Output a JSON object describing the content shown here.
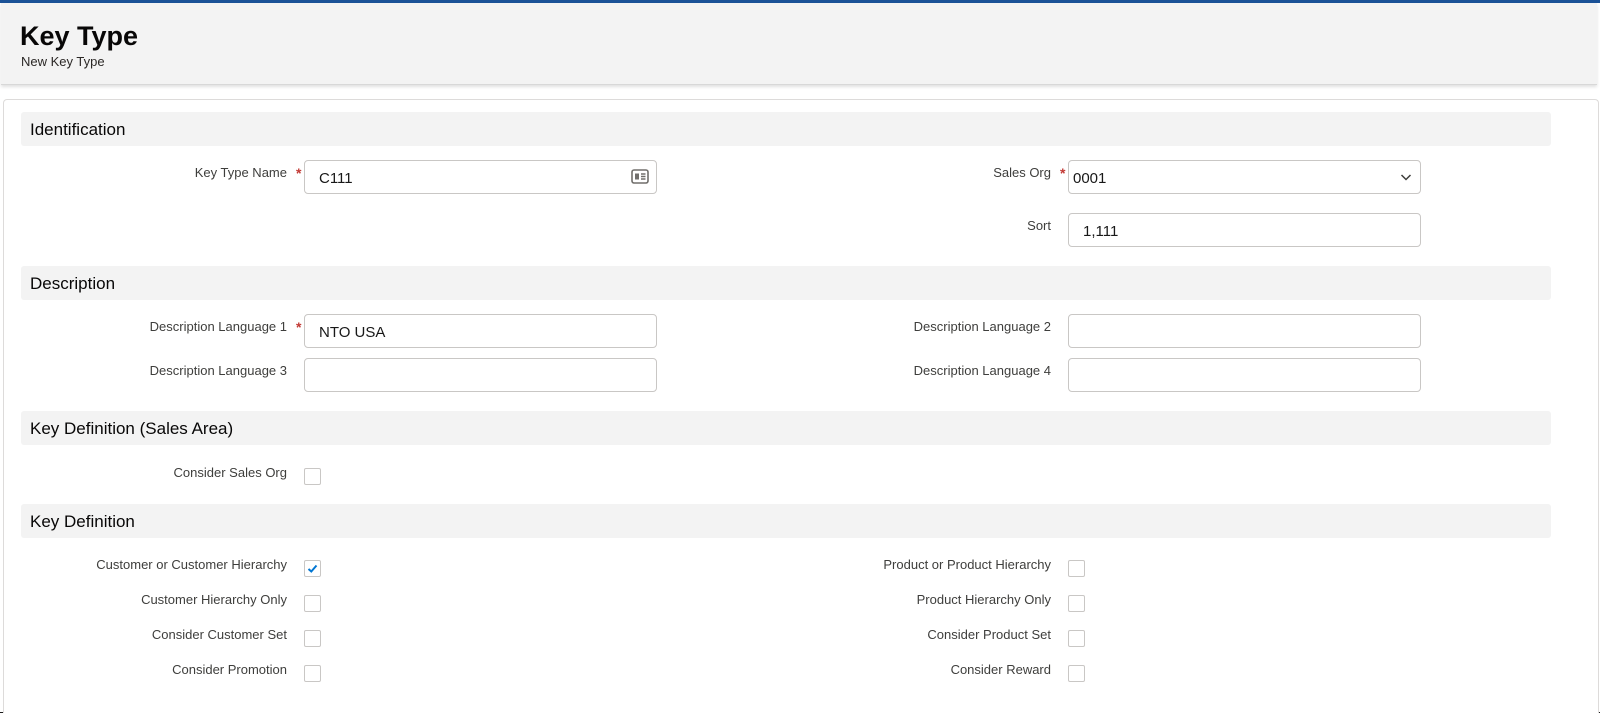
{
  "header": {
    "title": "Key Type",
    "subtitle": "New Key Type"
  },
  "sections": {
    "identification": "Identification",
    "description": "Description",
    "key_def_sales": "Key Definition (Sales Area)",
    "key_def": "Key Definition"
  },
  "fields": {
    "key_type_name": {
      "label": "Key Type Name",
      "value": "C111",
      "required": true
    },
    "sales_org": {
      "label": "Sales Org",
      "value": "0001",
      "required": true
    },
    "sort": {
      "label": "Sort",
      "value": "1,111"
    },
    "desc_lang_1": {
      "label": "Description Language 1",
      "value": "NTO USA",
      "required": true
    },
    "desc_lang_2": {
      "label": "Description Language 2",
      "value": ""
    },
    "desc_lang_3": {
      "label": "Description Language 3",
      "value": ""
    },
    "desc_lang_4": {
      "label": "Description Language 4",
      "value": ""
    }
  },
  "checkboxes": {
    "consider_sales_org": {
      "label": "Consider Sales Org",
      "checked": false
    },
    "customer_or_hierarchy": {
      "label": "Customer or Customer Hierarchy",
      "checked": true
    },
    "customer_hierarchy_only": {
      "label": "Customer Hierarchy Only",
      "checked": false
    },
    "consider_customer_set": {
      "label": "Consider Customer Set",
      "checked": false
    },
    "consider_promotion": {
      "label": "Consider Promotion",
      "checked": false
    },
    "product_or_hierarchy": {
      "label": "Product or Product Hierarchy",
      "checked": false
    },
    "product_hierarchy_only": {
      "label": "Product Hierarchy Only",
      "checked": false
    },
    "consider_product_set": {
      "label": "Consider Product Set",
      "checked": false
    },
    "consider_reward": {
      "label": "Consider Reward",
      "checked": false
    }
  },
  "icons": {
    "key_type_name_field": "contact-card-icon",
    "sales_org_field": "chevron-down-icon",
    "checkbox_checked": "checkmark-icon"
  },
  "colors": {
    "accent": "#1b5297",
    "required": "#c23934",
    "checkmark": "#0176d3"
  }
}
